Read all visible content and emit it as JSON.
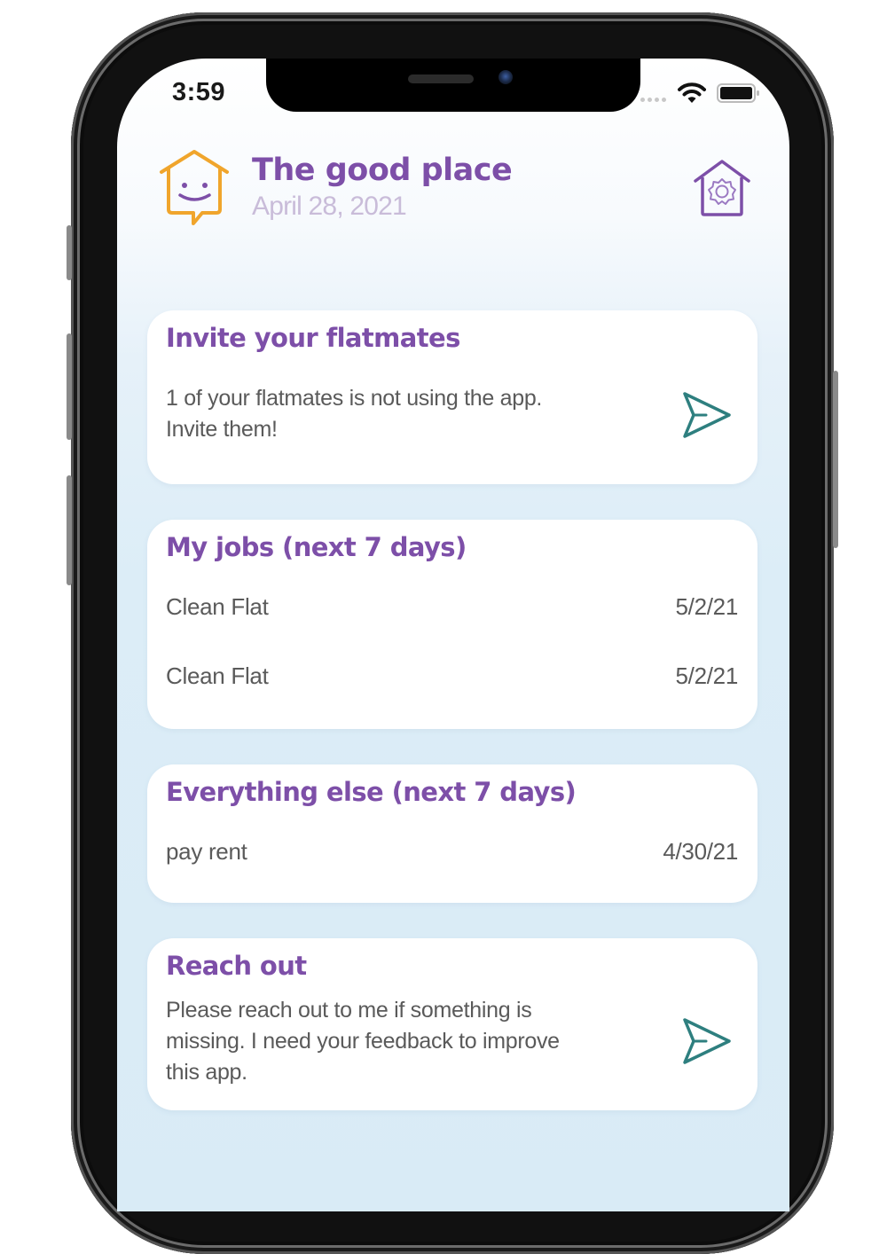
{
  "status_bar": {
    "time": "3:59",
    "wifi_icon": "wifi-icon",
    "battery_icon": "battery-icon"
  },
  "header": {
    "logo_icon": "smiling-house-icon",
    "title": "The good place",
    "date": "April 28, 2021",
    "settings_icon": "house-gear-icon"
  },
  "colors": {
    "accent_purple": "#7d4fa8",
    "logo_orange": "#f0a52c",
    "send_teal": "#2e7f7f",
    "date_lavender": "#c9bcd9",
    "body_text": "#5a5a5a",
    "background_blue": "#dcedf7"
  },
  "cards": {
    "invite": {
      "title": "Invite your flatmates",
      "text_line1": "1 of your flatmates is not using the app.",
      "text_line2": "Invite them!",
      "action_icon": "send-icon"
    },
    "jobs": {
      "title": "My jobs (next 7 days)",
      "items": [
        {
          "label": "Clean Flat",
          "date": "5/2/21"
        },
        {
          "label": "Clean Flat",
          "date": "5/2/21"
        }
      ]
    },
    "everything_else": {
      "title": "Everything else (next 7 days)",
      "items": [
        {
          "label": "pay rent",
          "date": "4/30/21"
        }
      ]
    },
    "reach_out": {
      "title": "Reach out",
      "text_line1": "Please reach out to me if something is",
      "text_line2": "missing. I need your feedback to improve",
      "text_line3": "this app.",
      "action_icon": "send-icon"
    }
  }
}
